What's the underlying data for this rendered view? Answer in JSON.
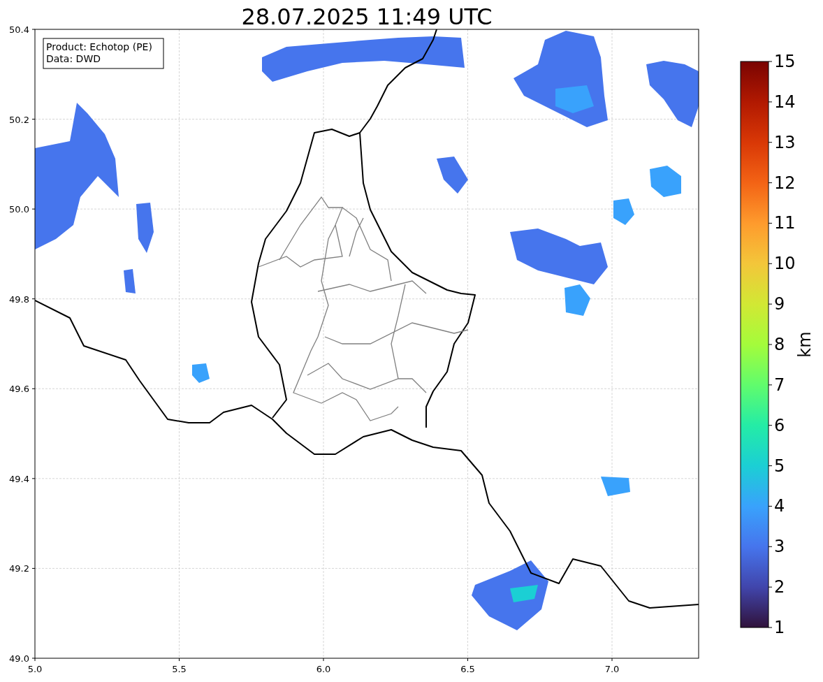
{
  "title": "28.07.2025 11:49 UTC",
  "info_box": {
    "lines": [
      "Product: Echotop (PE)",
      "Data: DWD"
    ]
  },
  "map": {
    "kind": "map",
    "x_ticks": [
      "5.0",
      "5.5",
      "6.0",
      "6.5",
      "7.0"
    ],
    "y_ticks": [
      "50.4",
      "50.2",
      "50.0",
      "49.8",
      "49.6",
      "49.4",
      "49.2",
      "49.0"
    ]
  },
  "colorbar": {
    "label": "km",
    "ticks": [
      "15",
      "14",
      "13",
      "12",
      "11",
      "10",
      "9",
      "8",
      "7",
      "6",
      "5",
      "4",
      "3",
      "2",
      "1"
    ]
  }
}
